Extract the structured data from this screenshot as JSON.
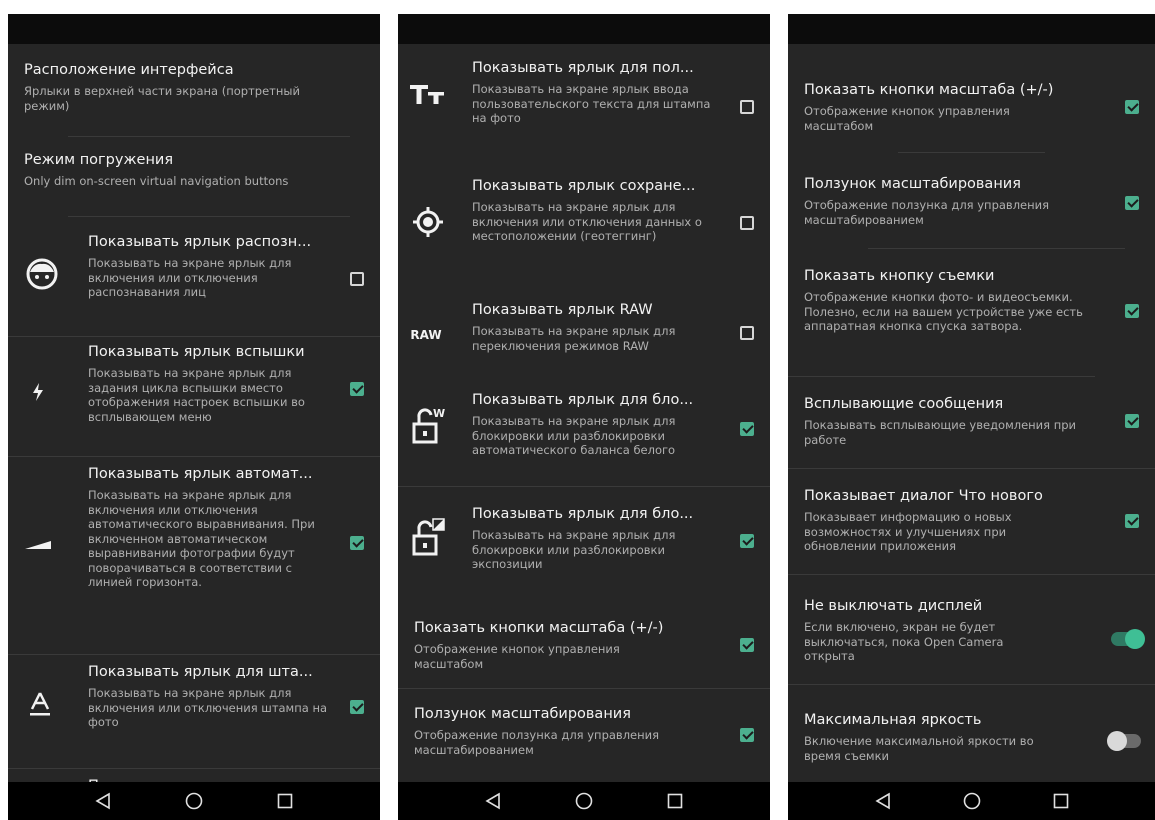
{
  "nav": {
    "back_icon": "back-icon",
    "home_icon": "home-icon",
    "recents_icon": "recents-icon"
  },
  "colors": {
    "accent": "#4caf8e",
    "background": "#262626",
    "navbar": "#000000"
  },
  "screen1": {
    "interface_layout": {
      "title": "Расположение интерфейса",
      "summary": "Ярлыки в верхней части экрана (портретный режим)"
    },
    "immersive_mode": {
      "title": "Режим погружения",
      "summary": "Only dim on-screen virtual navigation buttons"
    },
    "face_detection": {
      "title": "Показывать ярлык распозн...",
      "summary": "Показывать на экране ярлык для включения или отключения распознавания лиц",
      "checked": false
    },
    "flash": {
      "title": "Показывать ярлык вспышки",
      "summary": "Показывать на экране ярлык для задания цикла вспышки вместо отображения настроек вспышки во всплывающем меню",
      "checked": true
    },
    "auto_level": {
      "title": "Показывать ярлык автомат...",
      "summary": "Показывать на экране ярлык для включения или отключения автоматического выравнивания. При включенном автоматическом выравнивании фотографии будут поворачиваться в соответствии с линией горизонта.",
      "checked": true
    },
    "stamp": {
      "title": "Показывать ярлык для шта...",
      "summary": "Показывать на экране ярлык для включения или отключения штампа на фото",
      "checked": true
    },
    "partial": {
      "title": "П"
    }
  },
  "screen2": {
    "custom_text": {
      "title": "Показывать ярлык для пол...",
      "summary": "Показывать на экране ярлык ввода пользовательского текста для штампа на фото",
      "checked": false
    },
    "geotag": {
      "title": "Показывать ярлык сохране...",
      "summary": "Показывать на экране ярлык для включения или отключения данных о местоположении (геотеггинг)",
      "checked": false
    },
    "raw": {
      "title": "Показывать ярлык RAW",
      "summary": "Показывать на экране ярлык для переключения режимов RAW",
      "icon_text": "RAW",
      "checked": false
    },
    "wb_lock": {
      "title": "Показывать ярлык для бло...",
      "summary": "Показывать на экране ярлык для блокировки или разблокировки автоматического баланса белого",
      "icon_badge": "W",
      "checked": true
    },
    "exposure_lock": {
      "title": "Показывать ярлык для бло...",
      "summary": "Показывать на экране ярлык для блокировки или разблокировки экспозиции",
      "checked": true
    },
    "zoom_buttons": {
      "title": "Показать кнопки масштаба (+/-)",
      "summary": "Отображение кнопок управления масштабом",
      "checked": true
    },
    "zoom_slider": {
      "title": "Ползунок масштабирования",
      "summary": "Отображение ползунка для управления масштабированием",
      "checked": true
    }
  },
  "screen3": {
    "zoom_buttons": {
      "title": "Показать кнопки масштаба (+/-)",
      "summary": "Отображение кнопок управления масштабом",
      "checked": true
    },
    "zoom_slider": {
      "title": "Ползунок масштабирования",
      "summary": "Отображение ползунка для управления масштабированием",
      "checked": true
    },
    "shutter_button": {
      "title": "Показать кнопку съемки",
      "summary": "Отображение кнопки фото- и видеосъемки. Полезно, если на вашем устройстве уже есть аппаратная кнопка спуска затвора.",
      "checked": true
    },
    "toasts": {
      "title": "Всплывающие сообщения",
      "summary": "Показывать всплывающие уведомления при работе",
      "checked": true
    },
    "whats_new": {
      "title": "Показывает диалог Что нового",
      "summary": "Показывает информацию о новых возможностях и улучшениях при обновлении приложения",
      "checked": true
    },
    "keep_display_on": {
      "title": "Не выключать дисплей",
      "summary": "Если включено, экран не будет выключаться, пока Open Camera открыта",
      "on": true
    },
    "max_brightness": {
      "title": "Максимальная яркость",
      "summary": "Включение максимальной яркости во время съемки",
      "on": false
    }
  }
}
